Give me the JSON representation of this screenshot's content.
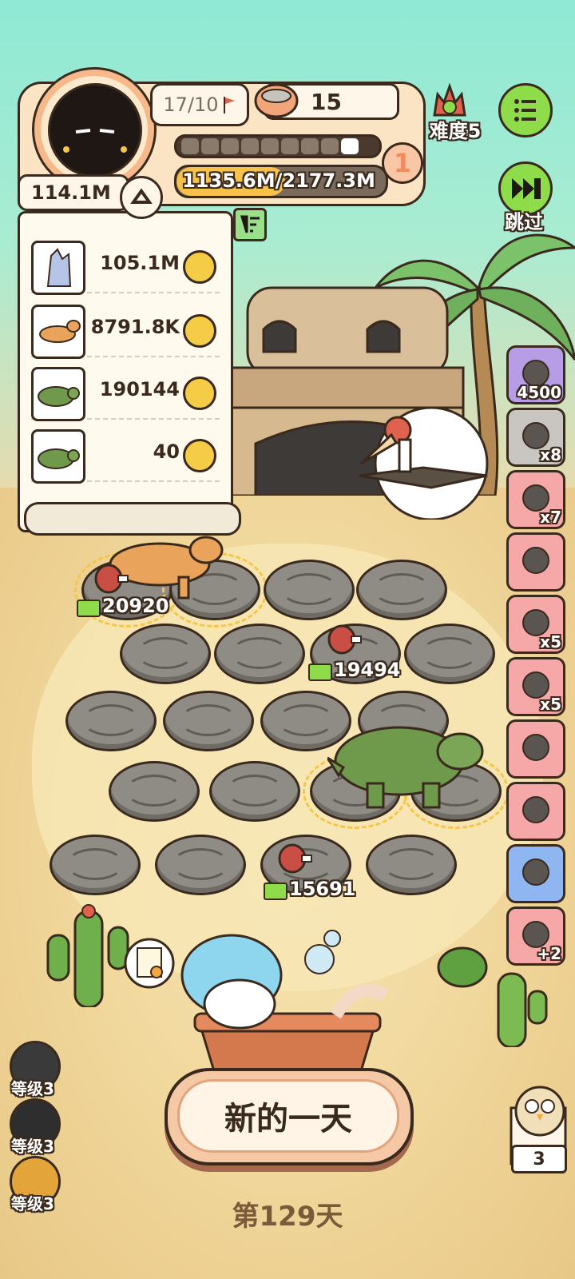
{
  "header": {
    "stage": "17/10",
    "food": "15",
    "pips_total": 9,
    "pips_filled": 1,
    "level": "1",
    "xp": "1135.6M/2177.3M",
    "xp_fraction": 0.52,
    "difficulty": "难度5",
    "skip": "跳过"
  },
  "resources": {
    "total": "114.1M",
    "rows": [
      {
        "icon": "crystal-icon",
        "value": "105.1M"
      },
      {
        "icon": "trex-icon",
        "value": "8791.8K"
      },
      {
        "icon": "ankylosaur-icon",
        "value": "190144"
      },
      {
        "icon": "ankylosaur-small-icon",
        "value": "40"
      }
    ]
  },
  "field": {
    "meat_values": [
      "20920",
      "19494",
      "15691"
    ]
  },
  "items": [
    {
      "icon": "ore-icon",
      "count": "4500",
      "color": "purple"
    },
    {
      "icon": "drill-icon",
      "count": "x8",
      "color": "gray"
    },
    {
      "icon": "bag-icon",
      "count": "x7",
      "color": "pink"
    },
    {
      "icon": "tools-icon",
      "count": "",
      "color": "pink"
    },
    {
      "icon": "crystal-icon",
      "count": "x5",
      "color": "pink"
    },
    {
      "icon": "tray-icon",
      "count": "x5",
      "color": "pink"
    },
    {
      "icon": "slime-rock-icon",
      "count": "",
      "color": "pink"
    },
    {
      "icon": "grill-icon",
      "count": "",
      "color": "pink"
    },
    {
      "icon": "camera-icon",
      "count": "",
      "color": "blue"
    },
    {
      "icon": "nugget-icon",
      "count": "+2",
      "color": "pink"
    }
  ],
  "levels": [
    {
      "label": "等级3"
    },
    {
      "label": "等级3"
    },
    {
      "label": "等级3"
    }
  ],
  "new_day": "新的一天",
  "day": "第129天",
  "bird_count": "3"
}
